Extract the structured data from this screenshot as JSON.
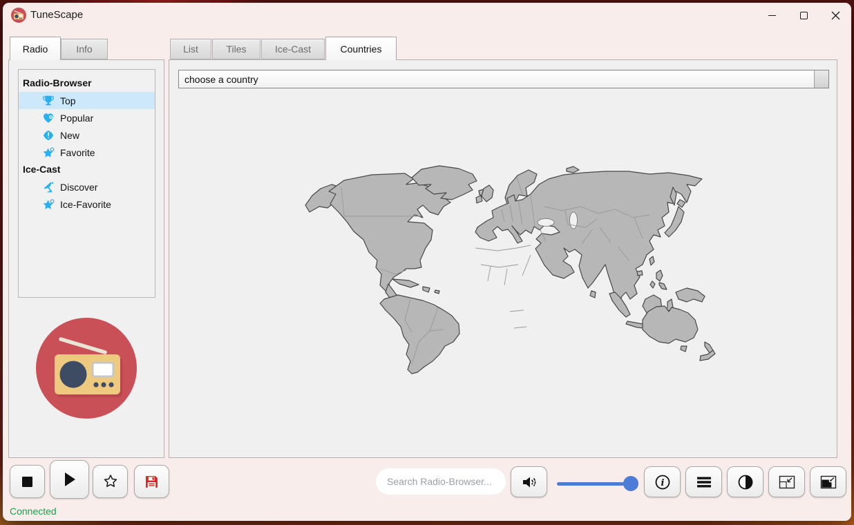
{
  "window": {
    "title": "TuneScape",
    "controls": [
      "minimize",
      "maximize",
      "close"
    ]
  },
  "left_tabs": {
    "items": [
      {
        "label": "Radio",
        "active": true
      },
      {
        "label": "Info",
        "active": false
      }
    ]
  },
  "sidebar": {
    "sections": [
      {
        "header": "Radio-Browser",
        "items": [
          {
            "label": "Top",
            "icon": "trophy-icon",
            "selected": true
          },
          {
            "label": "Popular",
            "icon": "heart-icon",
            "selected": false
          },
          {
            "label": "New",
            "icon": "new-badge-icon",
            "selected": false
          },
          {
            "label": "Favorite",
            "icon": "star-icon",
            "selected": false
          }
        ]
      },
      {
        "header": "Ice-Cast",
        "items": [
          {
            "label": "Discover",
            "icon": "satellite-dish-icon",
            "selected": false
          },
          {
            "label": "Ice-Favorite",
            "icon": "star-icon",
            "selected": false
          }
        ]
      }
    ],
    "icon_color": "#29b1ef",
    "selection_color": "#cde8fb"
  },
  "view_tabs": {
    "items": [
      {
        "label": "List",
        "active": false
      },
      {
        "label": "Tiles",
        "active": false
      },
      {
        "label": "Ice-Cast",
        "active": false
      },
      {
        "label": "Countries",
        "active": true
      }
    ]
  },
  "countries_view": {
    "combo_value": "choose a country",
    "map": "world-map-gray"
  },
  "player_bar": {
    "search_placeholder": "Search Radio-Browser...",
    "volume_percent": 100,
    "buttons": [
      {
        "name": "stop",
        "icon": "stop-icon"
      },
      {
        "name": "play",
        "icon": "play-icon"
      },
      {
        "name": "favorite",
        "icon": "star-outline-icon"
      },
      {
        "name": "record",
        "icon": "save-icon"
      },
      {
        "name": "volume",
        "icon": "speaker-icon"
      },
      {
        "name": "info",
        "icon": "info-icon"
      },
      {
        "name": "menu",
        "icon": "hamburger-icon"
      },
      {
        "name": "contrast",
        "icon": "contrast-icon"
      },
      {
        "name": "compact",
        "icon": "shrink-window-icon"
      },
      {
        "name": "mini",
        "icon": "shrink-window-filled-icon"
      }
    ]
  },
  "statusbar": {
    "text": "Connected",
    "color": "#18a34b"
  },
  "colors": {
    "window_bg": "#f8edea",
    "panel_bg": "#f0f0f0",
    "slider_accent": "#4d7cd6",
    "save_red": "#dc2020",
    "logo_red": "#c85056",
    "map_land": "#b7b7b7"
  }
}
